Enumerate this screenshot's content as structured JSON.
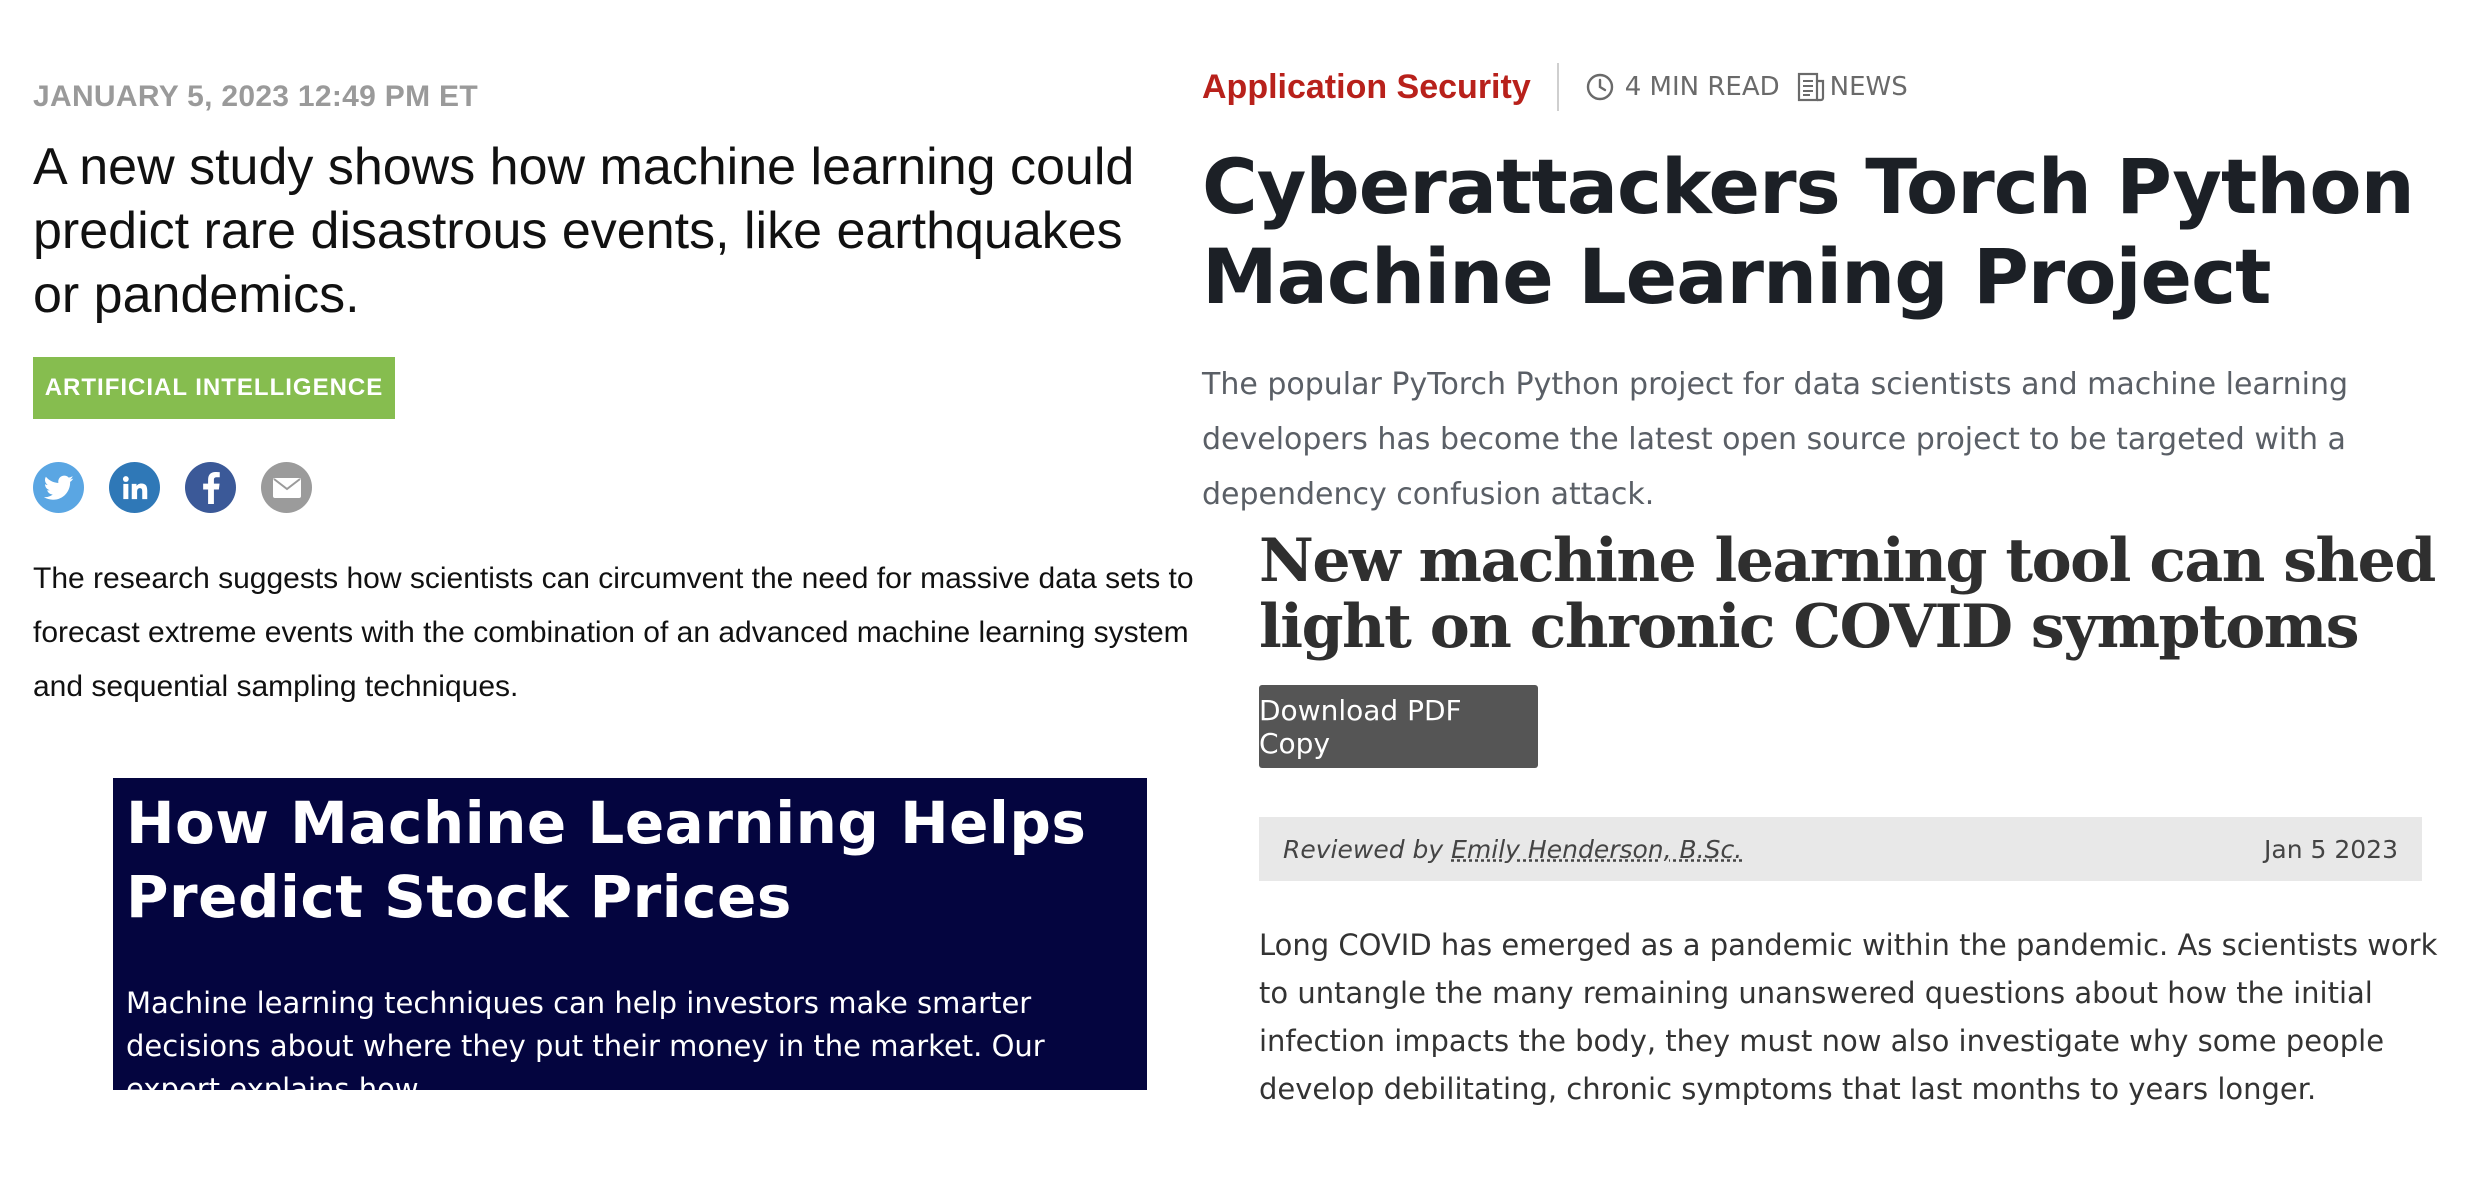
{
  "study_card": {
    "date": "JANUARY 5, 2023 12:49 PM ET",
    "headline": "A new study shows how machine learning could predict rare disastrous events, like earthquakes or pandemics.",
    "tag": "ARTIFICIAL INTELLIGENCE",
    "tag_color": "#86bd4f",
    "share_icons": [
      {
        "name": "twitter-icon",
        "color": "#5aa6e3"
      },
      {
        "name": "linkedin-icon",
        "color": "#2f78b7"
      },
      {
        "name": "facebook-icon",
        "color": "#3b5998"
      },
      {
        "name": "email-icon",
        "color": "#9b9b9b"
      }
    ],
    "summary": "The research suggests how scientists can circumvent the need for massive data sets to forecast extreme events with the combination of an advanced machine learning system and sequential sampling techniques."
  },
  "stock_card": {
    "title": "How Machine Learning Helps Predict Stock Prices",
    "body": "Machine learning techniques can help investors make smarter decisions about where they put their money in the market. Our expert explains how.",
    "background_color": "#04053f"
  },
  "cyber_card": {
    "category": "Application Security",
    "category_color": "#b8211b",
    "read_time": "4 MIN READ",
    "article_type": "NEWS",
    "title": "Cyberattackers Torch Python Machine Learning Project",
    "dek": "The popular PyTorch Python project for data scientists and machine learning developers has become the latest open source project to be targeted with a dependency confusion attack."
  },
  "covid_card": {
    "title": "New machine learning tool can shed light on chronic COVID symptoms",
    "download_button": "Download PDF Copy",
    "reviewed_by_label": "Reviewed by",
    "reviewer": "Emily Henderson, B.Sc.",
    "date": "Jan 5 2023",
    "body": "Long COVID has emerged as a pandemic within the pandemic. As scientists work to untangle the many remaining unanswered questions about how the initial infection impacts the body, they must now also investigate why some people develop debilitating, chronic symptoms that last months to years longer."
  }
}
